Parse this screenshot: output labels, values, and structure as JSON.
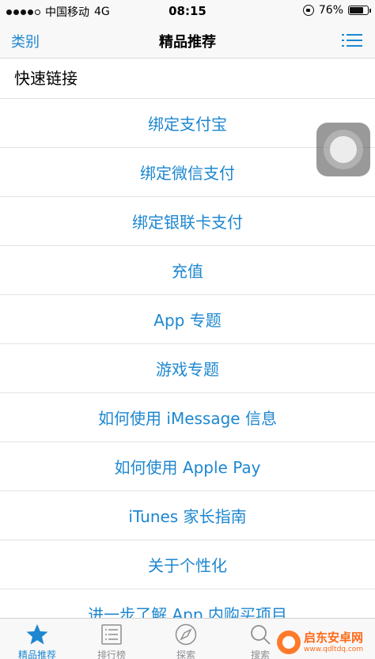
{
  "status_bar": {
    "carrier": "中国移动",
    "network": "4G",
    "time": "08:15",
    "battery": "76%",
    "battery_level": 0.76
  },
  "nav": {
    "left_label": "类别",
    "title": "精品推荐",
    "right_icon": "list-menu-icon"
  },
  "section": {
    "title": "快速链接"
  },
  "links": [
    "绑定支付宝",
    "绑定微信支付",
    "绑定银联卡支付",
    "充值",
    "App 专题",
    "游戏专题",
    "如何使用 iMessage 信息",
    "如何使用 Apple Pay",
    "iTunes 家长指南",
    "关于个性化",
    "进一步了解 App 内购买项目"
  ],
  "tabs": [
    {
      "label": "精品推荐",
      "icon": "star-icon",
      "active": true
    },
    {
      "label": "排行榜",
      "icon": "list-icon",
      "active": false
    },
    {
      "label": "探索",
      "icon": "compass-icon",
      "active": false
    },
    {
      "label": "搜索",
      "icon": "search-icon",
      "active": false
    }
  ],
  "watermark": {
    "brand": "启东安卓网",
    "url": "www.qdltdq.com"
  },
  "colors": {
    "accent": "#1d87d0",
    "inactive": "#8e8e93"
  }
}
